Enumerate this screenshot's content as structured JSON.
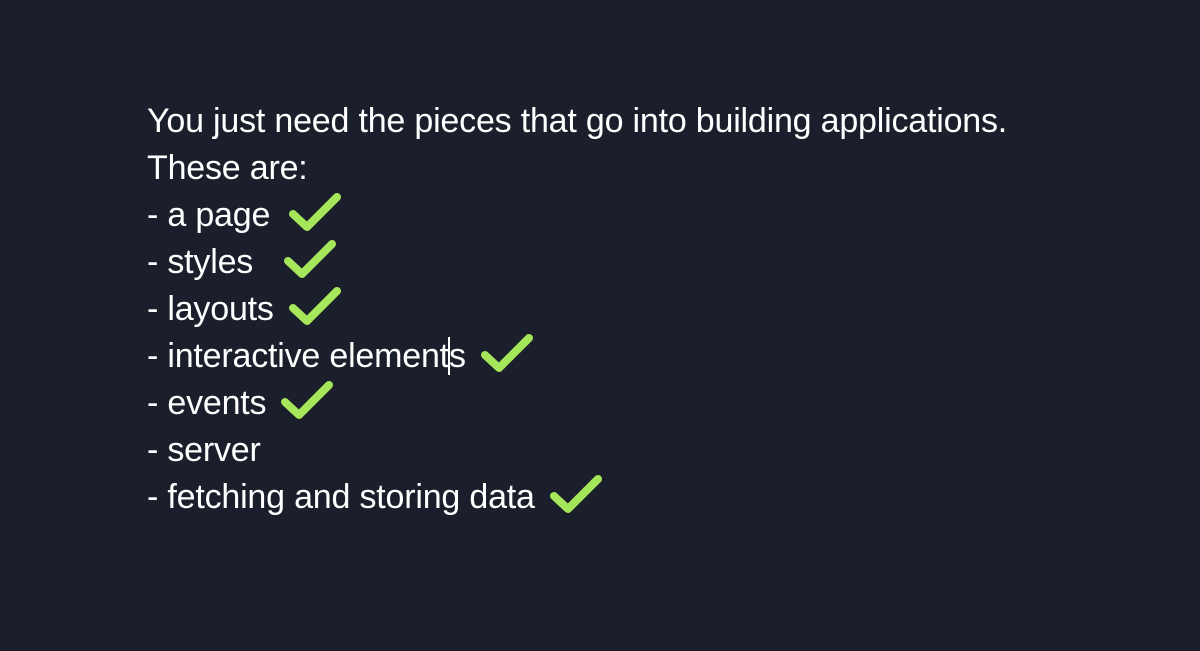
{
  "slide": {
    "intro_line": "You just need the pieces that go into building applications.",
    "subtitle_line": "These are:",
    "items": [
      {
        "text": "- a page",
        "checked": true
      },
      {
        "text": "- styles",
        "checked": true
      },
      {
        "text": "- layouts",
        "checked": true
      },
      {
        "text_before_caret": "- interactive element",
        "text_after_caret": "s",
        "checked": true
      },
      {
        "text": "- events",
        "checked": true
      },
      {
        "text": "- server",
        "checked": false
      },
      {
        "text": "- fetching and storing data",
        "checked": true
      }
    ],
    "check_color": "#a6e65a",
    "text_color": "#ffffff",
    "background_color": "#1b1f2b",
    "check_icon": "checkmark-icon"
  }
}
